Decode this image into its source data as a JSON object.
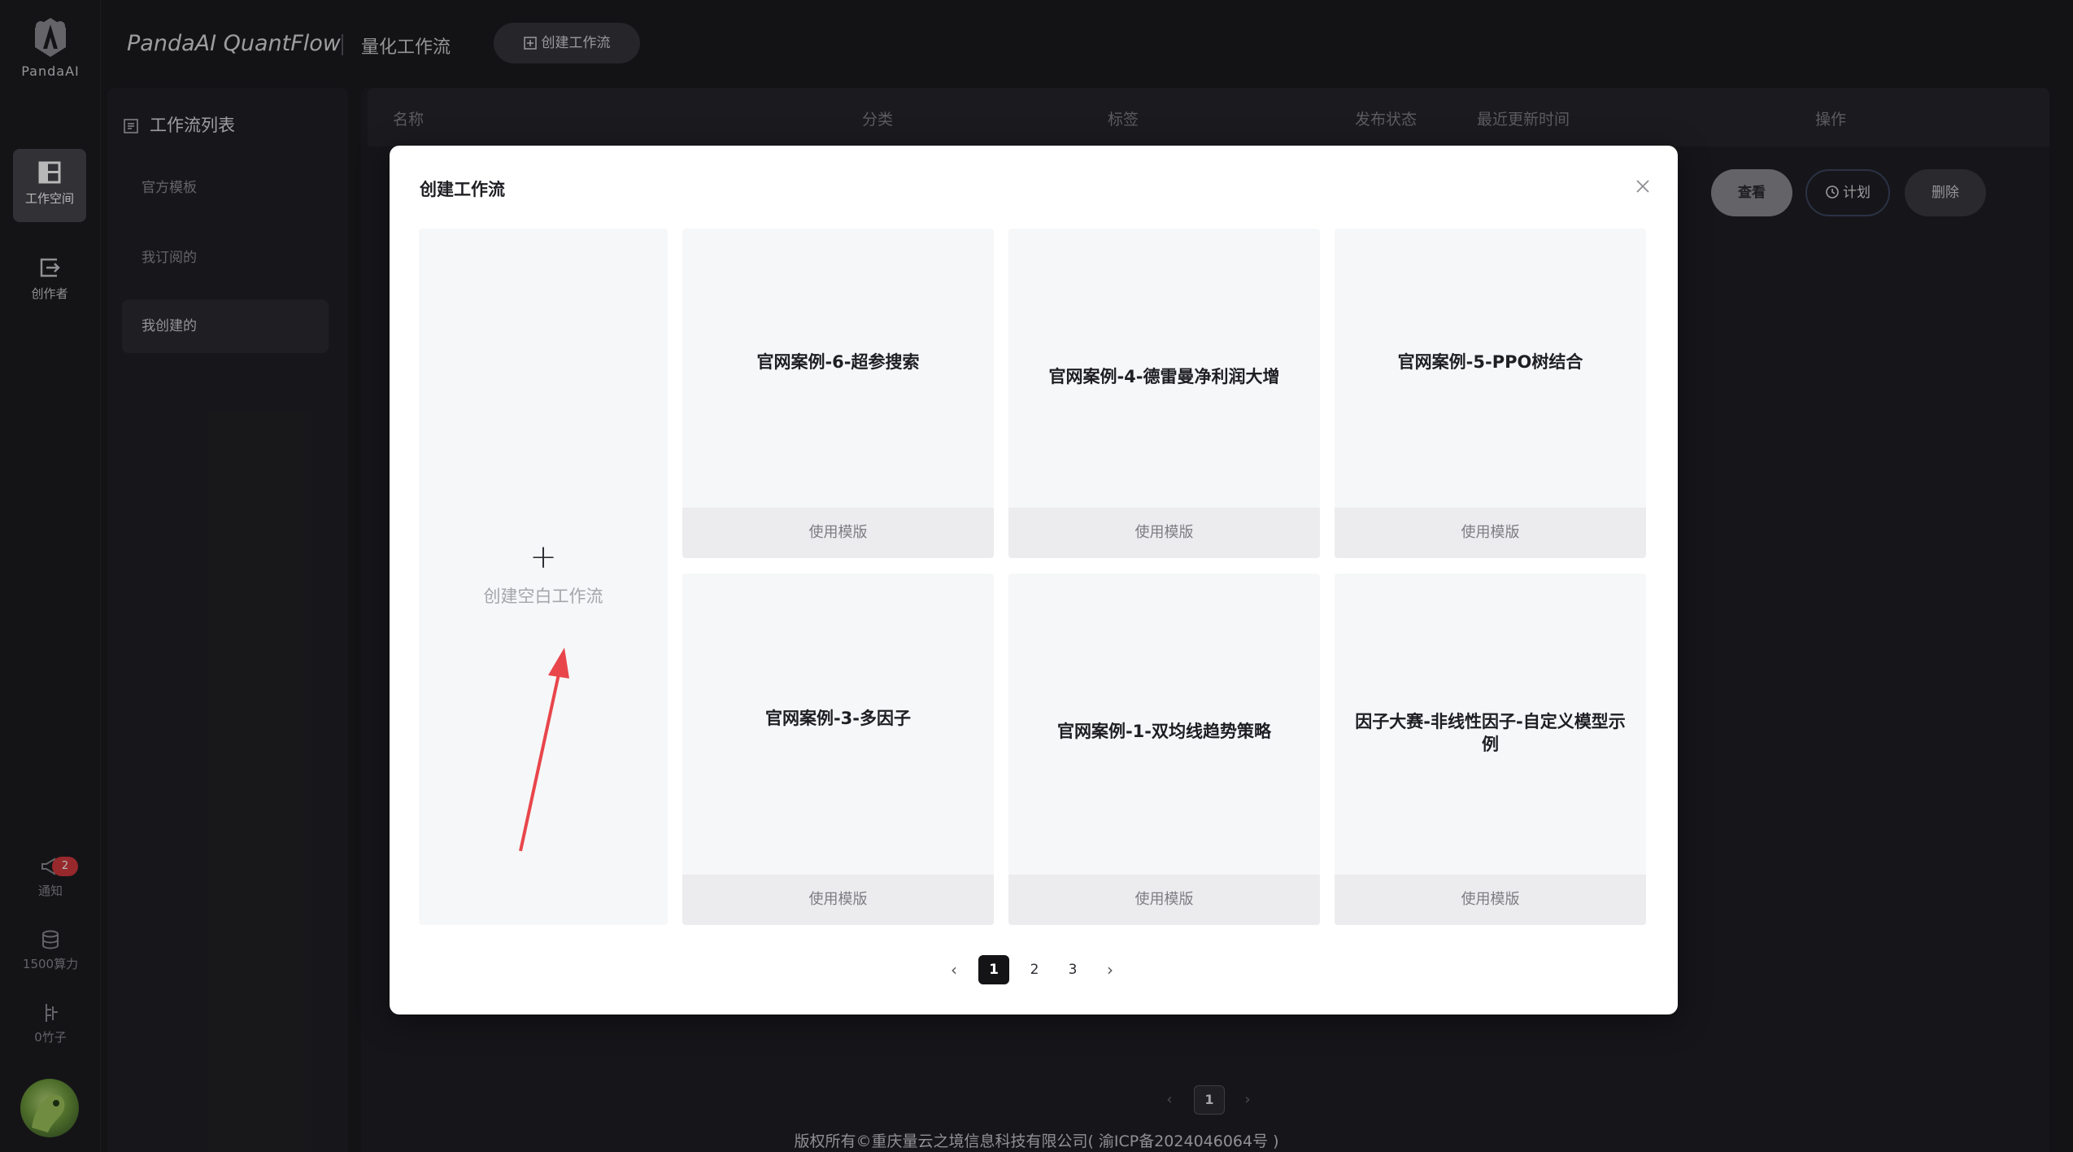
{
  "app": {
    "logo_text": "PandaAI",
    "brand": "PandaAI QuantFlow",
    "subtitle": "量化工作流",
    "create_button": "创建工作流"
  },
  "rail": {
    "workspace_label": "工作空间",
    "creator_label": "创作者",
    "notify_label": "通知",
    "notify_badge": "2",
    "compute_label": "1500算力",
    "bamboo_label": "0竹子"
  },
  "sidebar": {
    "title": "工作流列表",
    "items": [
      {
        "label": "官方模板"
      },
      {
        "label": "我订阅的"
      },
      {
        "label": "我创建的"
      }
    ]
  },
  "table": {
    "headers": [
      "名称",
      "分类",
      "标签",
      "发布状态",
      "最近更新时间",
      "操作"
    ],
    "row_actions": {
      "view": "查看",
      "plan": "计划",
      "delete": "删除"
    }
  },
  "bottom_pager": {
    "current": "1"
  },
  "footer": "版权所有©重庆量云之境信息科技有限公司( 渝ICP备2024046064号 )",
  "modal": {
    "title": "创建工作流",
    "blank_label": "创建空白工作流",
    "use_template_label": "使用模版",
    "templates": [
      {
        "title": "官网案例-6-超参搜索"
      },
      {
        "title": "官网案例-4-德雷曼净利润大增"
      },
      {
        "title": "官网案例-5-PPO树结合"
      },
      {
        "title": "官网案例-3-多因子"
      },
      {
        "title": "官网案例-1-双均线趋势策略"
      },
      {
        "title": "因子大赛-非线性因子-自定义模型示例"
      }
    ],
    "pagination": [
      "1",
      "2",
      "3"
    ],
    "current_page": "1"
  },
  "colors": {
    "accent_arrow": "#e8464b",
    "active_page": "#141416",
    "background": "#1b1b1f"
  }
}
